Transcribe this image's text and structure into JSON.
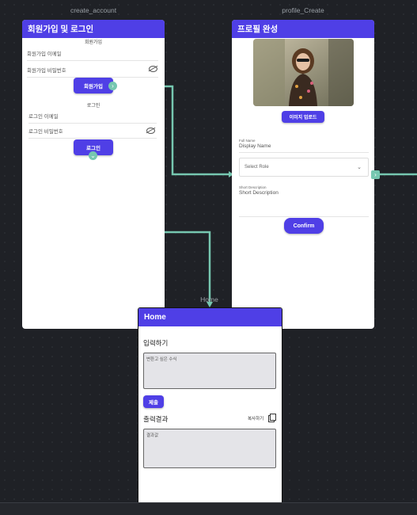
{
  "frames": {
    "create_account": {
      "label": "create_account",
      "appbar_title": "회원가입 및 로그인",
      "signup_section_label": "회원가입",
      "signup_email_placeholder": "회원가입 이메일",
      "signup_password_placeholder": "회원가입 비밀번호",
      "signup_button": "회원가입",
      "login_section_label": "로그인",
      "login_email_placeholder": "로그인 이메일",
      "login_password_placeholder": "로그인 비밀번호",
      "login_button": "로그인"
    },
    "profile_create": {
      "label": "profile_Create",
      "appbar_title": "프로필 완성",
      "upload_button": "이미지 업로드",
      "fullname_label": "Full Name",
      "fullname_placeholder": "Display Name",
      "role_placeholder": "Select Role",
      "short_desc_label": "Short Description",
      "short_desc_placeholder": "Short Description",
      "confirm_button": "Confirm"
    },
    "home": {
      "label": "Home",
      "appbar_title": "Home",
      "input_heading": "입력하기",
      "input_placeholder": "변환고 싶은 수식",
      "submit_button": "제출",
      "output_heading": "출력결과",
      "copy_label": "복사하기",
      "output_value": "결과값"
    }
  },
  "colors": {
    "accent": "#4f3fe6",
    "connector": "#76c7b0",
    "canvas": "#1f2126"
  }
}
